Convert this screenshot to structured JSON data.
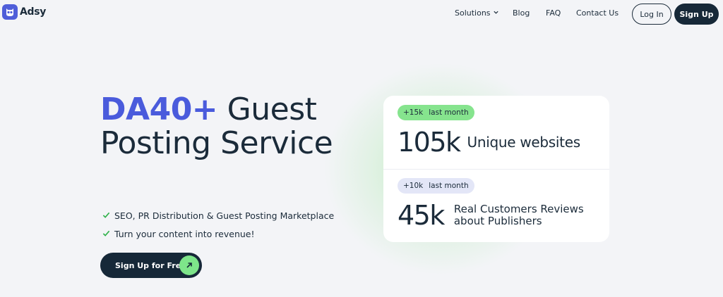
{
  "brand": {
    "name": "Adsy"
  },
  "nav": {
    "solutions": "Solutions",
    "blog": "Blog",
    "faq": "FAQ",
    "contact": "Contact Us",
    "login": "Log In",
    "signup": "Sign Up"
  },
  "hero": {
    "title_accent": "DA40+",
    "title_rest": " Guest Posting Service",
    "features": [
      "SEO, PR Distribution & Guest Posting Marketplace",
      "Turn your content into revenue!"
    ],
    "cta": "Sign Up for Free"
  },
  "stats": [
    {
      "badge_value": "+15k",
      "badge_period": "last month",
      "number": "105k",
      "label": "Unique websites"
    },
    {
      "badge_value": "+10k",
      "badge_period": "last month",
      "number": "45k",
      "label": "Real Customers Reviews about Publishers"
    }
  ],
  "colors": {
    "accent": "#4a5bdc",
    "dark": "#162838",
    "green": "#86e48e",
    "lavender": "#e3e6f7",
    "background": "#f3f4f7"
  },
  "icons": {
    "logo": "owl-logo-icon",
    "solutions": "chevron-down-icon",
    "feature": "check-icon",
    "cta": "arrow-up-right-icon"
  }
}
